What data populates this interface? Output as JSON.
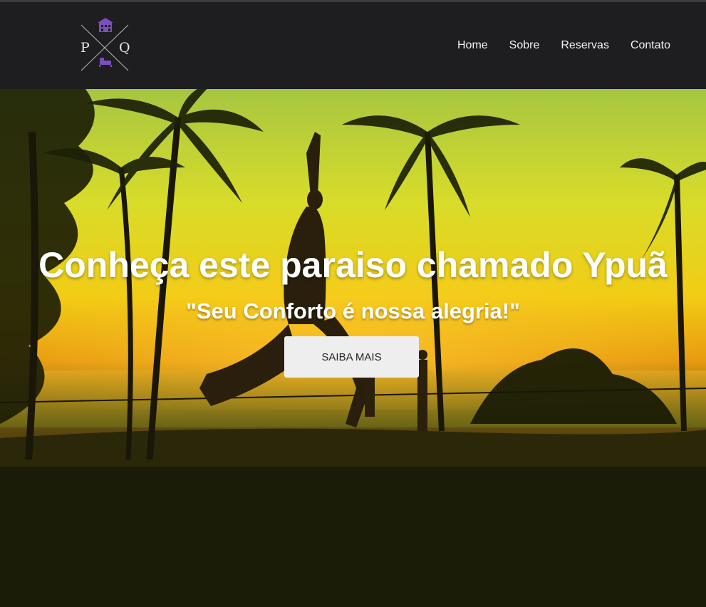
{
  "header": {
    "logo": {
      "letter_left": "P",
      "letter_right": "Q",
      "top_icon": "building-icon",
      "bottom_icon": "bed-icon",
      "accent_color": "#7b4fc0"
    },
    "nav": [
      {
        "label": "Home"
      },
      {
        "label": "Sobre"
      },
      {
        "label": "Reservas"
      },
      {
        "label": "Contato"
      }
    ]
  },
  "hero": {
    "title": "Conheça este paraiso chamado Ypuã",
    "subtitle": "\"Seu Conforto é nossa alegria!\"",
    "cta_label": "SAIBA MAIS",
    "background": "sunset-beach-palm-trees-slackline-photo"
  },
  "colors": {
    "header_bg": "#1e1e20",
    "page_bg": "#1a1c08",
    "sky_top": "#9cc83a",
    "sky_mid": "#f0e020",
    "sunset": "#f0a010"
  }
}
